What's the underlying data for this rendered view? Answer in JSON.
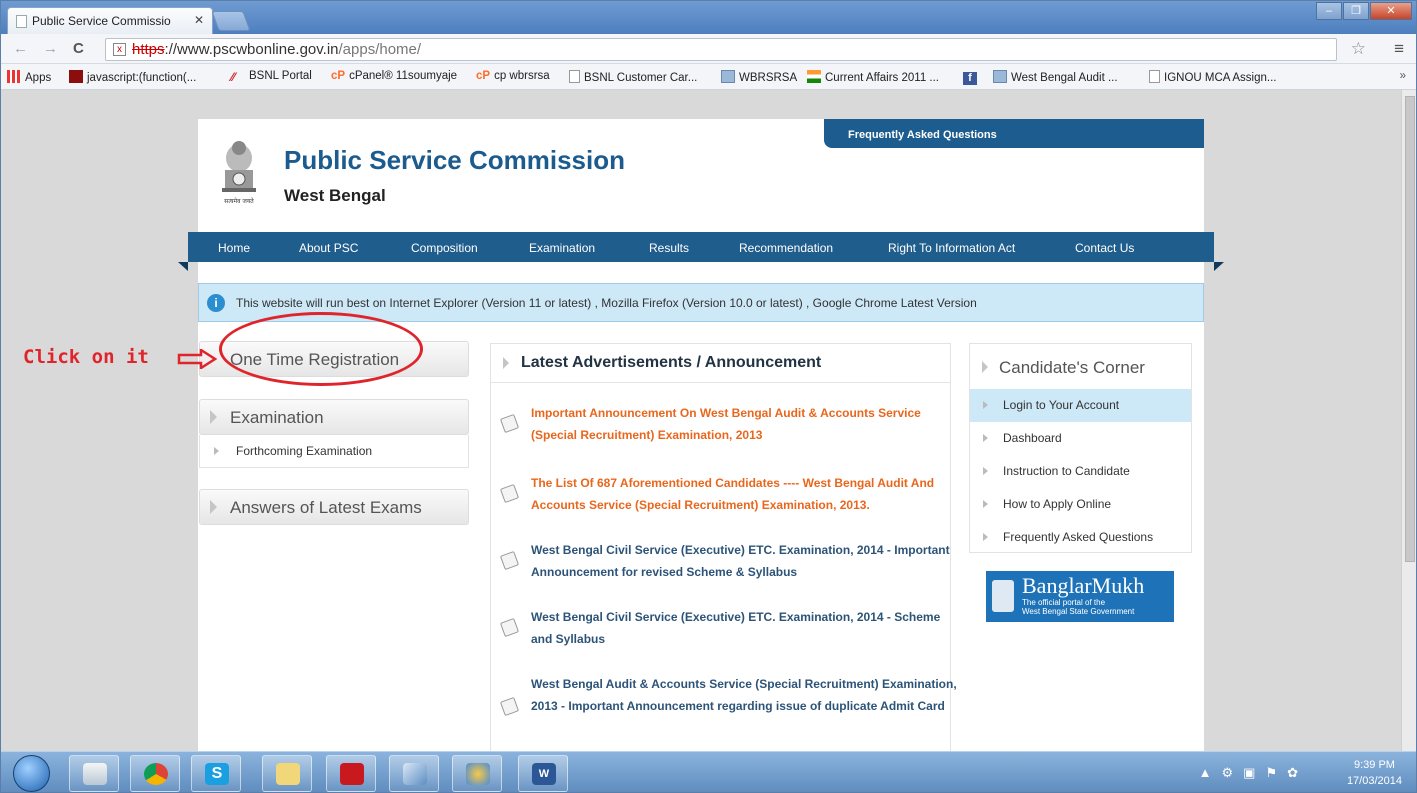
{
  "browser": {
    "tab_title": "Public Service Commissio",
    "url_scheme": "https",
    "url_rest": "://www.pscwbonline.gov.in",
    "url_path": "/apps/home/",
    "bookmarks": [
      "Apps",
      "javascript:(function(...",
      "BSNL Portal",
      "cPanel® 11soumyaje",
      "cp wbrsrsa",
      "BSNL Customer Car...",
      "WBRSRSA",
      "Current Affairs 2011 ...",
      "West Bengal Audit ...",
      "IGNOU MCA Assign..."
    ],
    "overflow_label": "»"
  },
  "site": {
    "title": "Public Service Commission",
    "subtitle": "West Bengal",
    "emblem_motto": "सत्यमेव जयते",
    "faq_tab": "Frequently Asked Questions",
    "nav": [
      "Home",
      "About PSC",
      "Composition",
      "Examination",
      "Results",
      "Recommendation",
      "Right To Information Act",
      "Contact Us"
    ],
    "notice": "This website will run best on Internet Explorer (Version 11 or latest) , Mozilla Firefox (Version 10.0 or latest) , Google Chrome Latest Version"
  },
  "sidebar": {
    "otr": "One Time Registration",
    "examination": "Examination",
    "forthcoming": "Forthcoming Examination",
    "answers": "Answers of Latest Exams"
  },
  "announcements": {
    "heading": "Latest Advertisements / Announcement",
    "items": [
      {
        "text": "Important Announcement On West Bengal Audit & Accounts Service (Special Recruitment) Examination, 2013",
        "color": "#e8671d"
      },
      {
        "text": "The List Of 687 Aforementioned Candidates ---- West Bengal Audit And Accounts Service (Special Recruitment) Examination, 2013.",
        "color": "#e8671d"
      },
      {
        "text": "West Bengal Civil Service (Executive) ETC. Examination, 2014 - Important Announcement for revised Scheme & Syllabus",
        "color": "#2d5478"
      },
      {
        "text": "West Bengal Civil Service (Executive) ETC. Examination, 2014 - Scheme and Syllabus",
        "color": "#2d5478"
      },
      {
        "text": "West Bengal Audit & Accounts Service (Special Recruitment) Examination, 2013 - Important Announcement regarding issue of duplicate Admit Card",
        "color": "#2d5478"
      }
    ]
  },
  "candidate_corner": {
    "heading": "Candidate's Corner",
    "items": [
      "Login to Your Account",
      "Dashboard",
      "Instruction to Candidate",
      "How to Apply Online",
      "Frequently Asked Questions"
    ],
    "active_index": 0
  },
  "banglarmukh": {
    "title": "BanglarMukh",
    "line1": "The official portal of  the",
    "line2": "West Bengal State Government"
  },
  "annotation": {
    "text": "Click on it",
    "color": "#e0242c"
  },
  "taskbar": {
    "time": "9:39 PM",
    "date": "17/03/2014"
  }
}
